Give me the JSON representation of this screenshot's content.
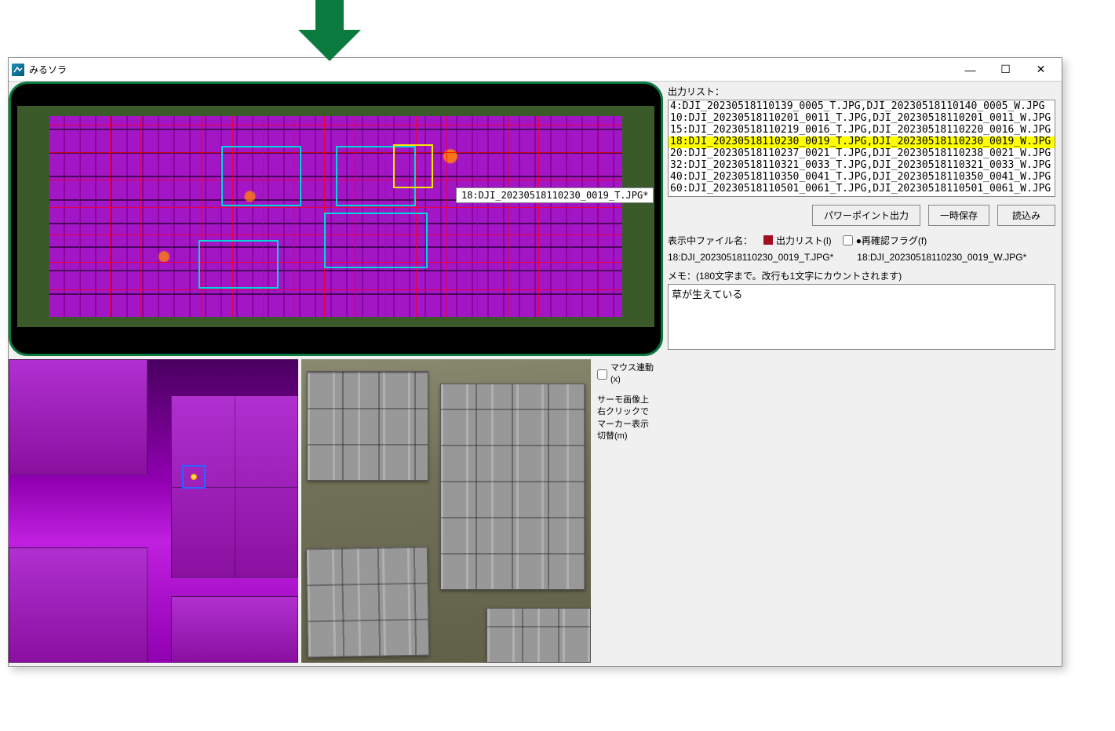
{
  "annotation": {
    "arrow_color": "#0a7a3f"
  },
  "window": {
    "title": "みるソラ",
    "controls": {
      "minimize": "—",
      "maximize": "☐",
      "close": "✕"
    }
  },
  "overview": {
    "tooltip": "18:DJI_20230518110230_0019_T.JPG*"
  },
  "side_help": {
    "mouse_link_label": "マウス連動 (x)",
    "mouse_link_checked": false,
    "help_line1": "サーモ画像上",
    "help_line2": "右クリックで",
    "help_line3": "マーカー表示",
    "help_line4": "切替(m)"
  },
  "output": {
    "label": "出力リスト：",
    "items": [
      {
        "text": "4:DJI_20230518110139_0005_T.JPG,DJI_20230518110140_0005_W.JPG",
        "selected": false
      },
      {
        "text": "10:DJI_20230518110201_0011_T.JPG,DJI_20230518110201_0011_W.JPG",
        "selected": false
      },
      {
        "text": "15:DJI_20230518110219_0016_T.JPG,DJI_20230518110220_0016_W.JPG",
        "selected": false
      },
      {
        "text": "18:DJI_20230518110230_0019_T.JPG,DJI_20230518110230_0019_W.JPG",
        "selected": true
      },
      {
        "text": "20:DJI_20230518110237_0021_T.JPG,DJI_20230518110238_0021_W.JPG",
        "selected": false
      },
      {
        "text": "32:DJI_20230518110321_0033_T.JPG,DJI_20230518110321_0033_W.JPG",
        "selected": false
      },
      {
        "text": "40:DJI_20230518110350_0041_T.JPG,DJI_20230518110350_0041_W.JPG",
        "selected": false
      },
      {
        "text": "60:DJI_20230518110501_0061_T.JPG,DJI_20230518110501_0061_W.JPG",
        "selected": false
      }
    ]
  },
  "buttons": {
    "ppt_export": "パワーポイント出力",
    "temp_save": "一時保存",
    "load": "読込み"
  },
  "info": {
    "current_file_label": "表示中ファイル名：",
    "output_list_chk_label": "出力リスト(l)",
    "output_list_checked": true,
    "reconfirm_chk_label": "●再確認フラグ(f)",
    "reconfirm_checked": false,
    "file_t": "18:DJI_20230518110230_0019_T.JPG*",
    "file_w": "18:DJI_20230518110230_0019_W.JPG*",
    "memo_label": "メモ：(180文字まで。改行も1文字にカウントされます)",
    "memo_value": "草が生えている"
  }
}
